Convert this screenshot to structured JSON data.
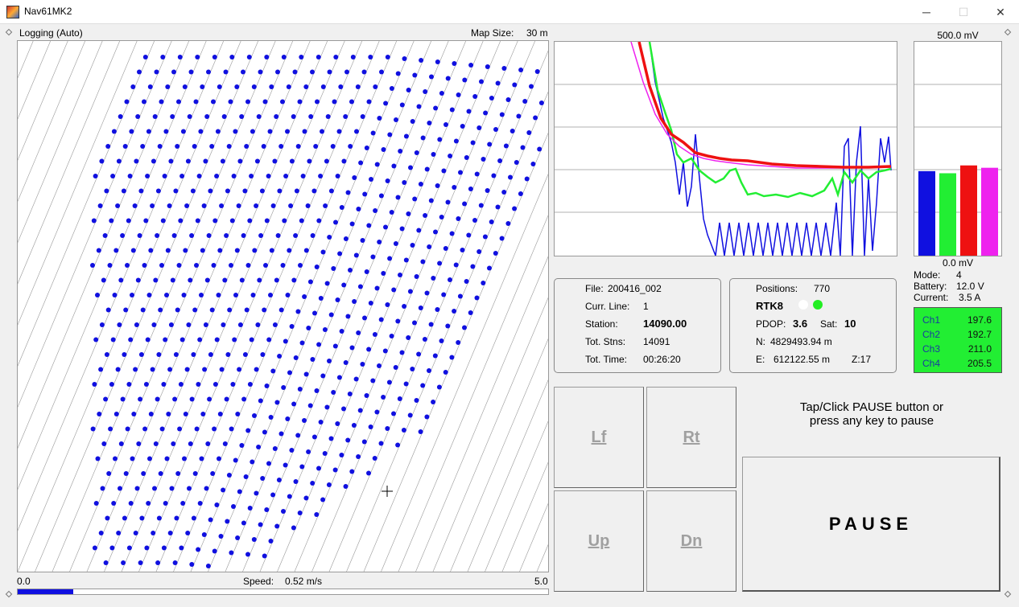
{
  "window": {
    "title": "Nav61MK2",
    "minimize": "─",
    "maximize": "☐",
    "close": "✕"
  },
  "map": {
    "mode_label": "Logging (Auto)",
    "map_size_label": "Map Size:",
    "map_size_value": "30 m"
  },
  "speed": {
    "min": "0.0",
    "max": "5.0",
    "label": "Speed:",
    "value": "0.52 m/s",
    "fraction": 0.104
  },
  "bars": {
    "top_label": "500.0 mV",
    "bottom_label": "0.0 mV",
    "colors": [
      "#1010e0",
      "#22ee33",
      "#ee1111",
      "#ee22ee"
    ],
    "values_mv": [
      197.6,
      192.7,
      211.0,
      205.5
    ]
  },
  "status": {
    "mode_label": "Mode:",
    "mode_value": "4",
    "battery_label": "Battery:",
    "battery_value": "12.0 V",
    "current_label": "Current:",
    "current_value": "3.5 A"
  },
  "channels": [
    {
      "name": "Ch1",
      "value": "197.6"
    },
    {
      "name": "Ch2",
      "value": "192.7"
    },
    {
      "name": "Ch3",
      "value": "211.0"
    },
    {
      "name": "Ch4",
      "value": "205.5"
    }
  ],
  "info1": {
    "file_label": "File:",
    "file_value": "200416_002",
    "line_label": "Curr. Line:",
    "line_value": "1",
    "station_label": "Station:",
    "station_value": "14090.00",
    "stns_label": "Tot. Stns:",
    "stns_value": "14091",
    "time_label": "Tot. Time:",
    "time_value": "00:26:20"
  },
  "info2": {
    "positions_label": "Positions:",
    "positions_value": "770",
    "rtk_label": "RTK8",
    "pdop_label": "PDOP:",
    "pdop_value": "3.6",
    "sat_label": "Sat:",
    "sat_value": "10",
    "n_label": "N:",
    "n_value": "4829493.94 m",
    "e_label": "E:",
    "e_value": "612122.55 m",
    "z_label": "Z:17"
  },
  "nav_buttons": {
    "left": "Lf",
    "right": "Rt",
    "up": "Up",
    "down": "Dn"
  },
  "hint": {
    "line1": "Tap/Click PAUSE button or",
    "line2": "press any key to pause"
  },
  "pause_label": "PAUSE",
  "colors": {
    "blue": "#1010e0",
    "green": "#22ee33",
    "red": "#ee1111",
    "magenta": "#ee22ee",
    "gps_ok": "#22ee22"
  }
}
